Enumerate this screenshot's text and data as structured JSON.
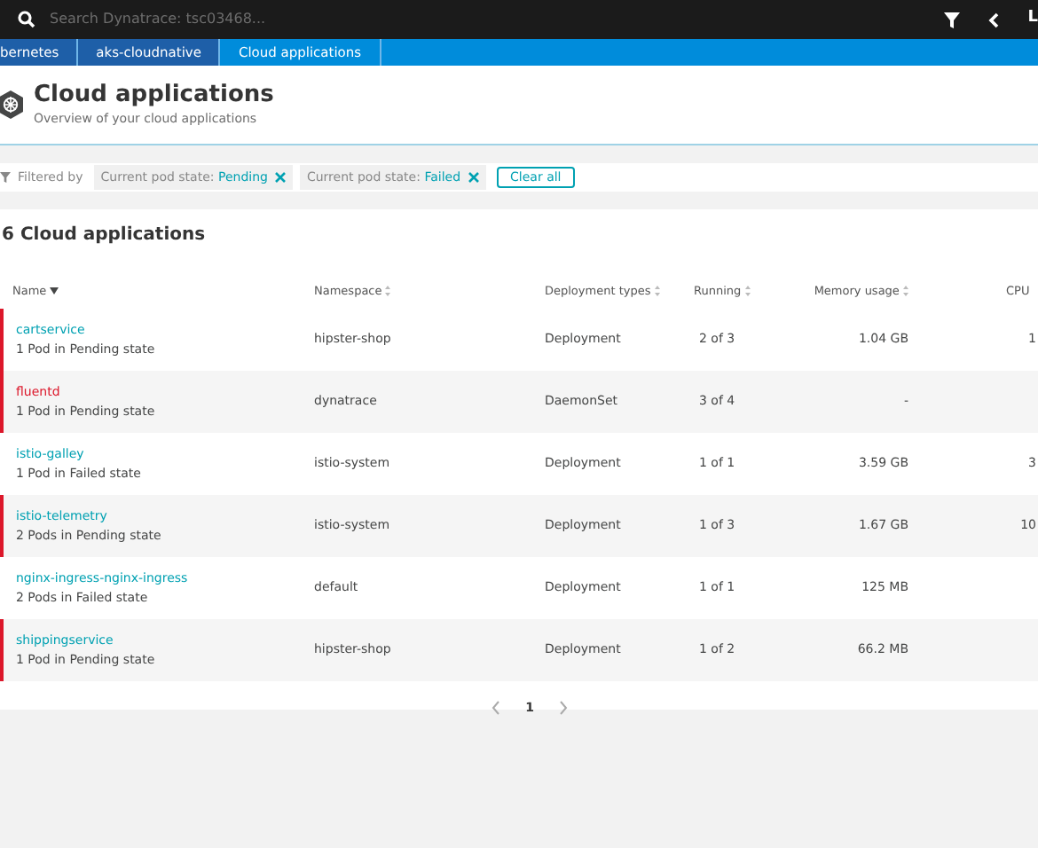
{
  "top_bar": {
    "search_placeholder": "Search Dynatrace: tsc03468...",
    "user_initial": "L"
  },
  "breadcrumbs": [
    {
      "label": "bernetes",
      "selected": false
    },
    {
      "label": "aks-cloudnative",
      "selected": false
    },
    {
      "label": "Cloud applications",
      "selected": true
    }
  ],
  "header": {
    "title": "Cloud applications",
    "subtitle": "Overview of your cloud applications"
  },
  "filters": {
    "label": "Filtered by",
    "chips": [
      {
        "key": "Current pod state: ",
        "value": "Pending"
      },
      {
        "key": "Current pod state: ",
        "value": "Failed"
      }
    ],
    "clear": "Clear all"
  },
  "table": {
    "title": "6 Cloud applications",
    "columns": [
      {
        "label": "Name",
        "sorted": true
      },
      {
        "label": "Namespace",
        "sorted": false
      },
      {
        "label": "Deployment types",
        "sorted": false
      },
      {
        "label": "Running",
        "sorted": false
      },
      {
        "label": "Memory usage",
        "sorted": false
      },
      {
        "label": "CPU"
      }
    ],
    "rows": [
      {
        "name": "cartservice",
        "status": "1 Pod in Pending state",
        "namespace": "hipster-shop",
        "type": "Deployment",
        "running": "2 of 3",
        "memory": "1.04 GB",
        "cpu": "1",
        "problem": true,
        "alert": false
      },
      {
        "name": "fluentd",
        "status": "1 Pod in Pending state",
        "namespace": "dynatrace",
        "type": "DaemonSet",
        "running": "3 of 4",
        "memory": "-",
        "problem": true,
        "alert": true
      },
      {
        "name": "istio-galley",
        "status": "1 Pod in Failed state",
        "namespace": "istio-system",
        "type": "Deployment",
        "running": "1 of 1",
        "memory": "3.59 GB",
        "cpu": "3",
        "problem": false,
        "alert": false
      },
      {
        "name": "istio-telemetry",
        "status": "2 Pods in Pending state",
        "namespace": "istio-system",
        "type": "Deployment",
        "running": "1 of 3",
        "memory": "1.67 GB",
        "cpu": "10",
        "problem": true,
        "alert": false
      },
      {
        "name": "nginx-ingress-nginx-ingress",
        "status": "2 Pods in Failed state",
        "namespace": "default",
        "type": "Deployment",
        "running": "1 of 1",
        "memory": "125 MB",
        "problem": false,
        "alert": false
      },
      {
        "name": "shippingservice",
        "status": "1 Pod in Pending state",
        "namespace": "hipster-shop",
        "type": "Deployment",
        "running": "1 of 2",
        "memory": "66.2 MB",
        "problem": true,
        "alert": false
      }
    ]
  },
  "pagination": {
    "pages": [
      {
        "label": "1",
        "selected": true
      }
    ]
  }
}
